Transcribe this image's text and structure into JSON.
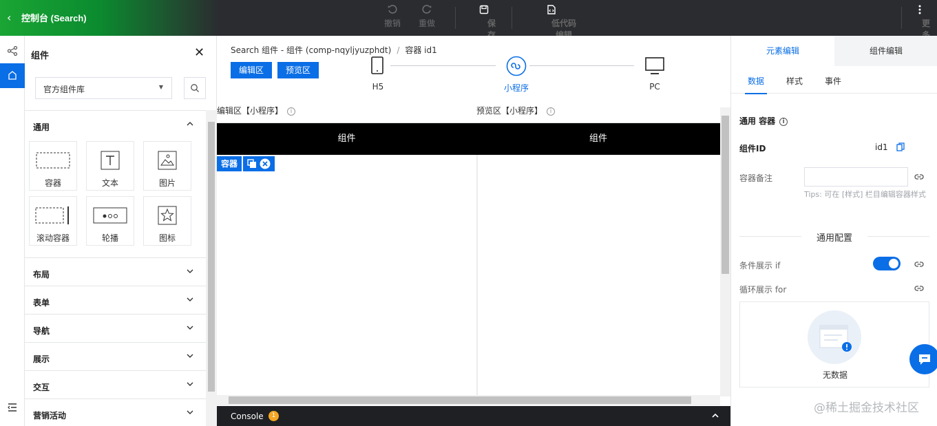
{
  "topbar": {
    "title": "控制台 (Search)",
    "undo_label": "撤销",
    "redo_label": "重做",
    "save_label": "保存",
    "lowcode_label": "低代码编辑",
    "more_label": "更多"
  },
  "left_panel": {
    "title": "组件",
    "library_select": "官方组件库",
    "categories": [
      {
        "name": "通用",
        "expanded": true
      },
      {
        "name": "布局"
      },
      {
        "name": "表单"
      },
      {
        "name": "导航"
      },
      {
        "name": "展示"
      },
      {
        "name": "交互"
      },
      {
        "name": "营销活动"
      }
    ],
    "components": [
      {
        "label": "容器",
        "icon": "container-icon"
      },
      {
        "label": "文本",
        "icon": "text-icon"
      },
      {
        "label": "图片",
        "icon": "image-icon"
      },
      {
        "label": "滚动容器",
        "icon": "scroll-container-icon"
      },
      {
        "label": "轮播",
        "icon": "carousel-icon"
      },
      {
        "label": "图标",
        "icon": "star-icon"
      }
    ]
  },
  "main": {
    "breadcrumb": {
      "path": "Search 组件 - 组件 (comp-nqyljyuzphdt)",
      "current": "容器 id1"
    },
    "edit_area_button": "编辑区",
    "preview_area_button": "预览区",
    "platforms": [
      {
        "label": "H5"
      },
      {
        "label": "小程序",
        "active": true
      },
      {
        "label": "PC"
      }
    ],
    "edit_area_header": "编辑区【小程序】",
    "preview_area_header": "预览区【小程序】",
    "edit_block_title": "组件",
    "preview_block_title": "组件",
    "selection_tag": "容器",
    "console_label": "Console",
    "console_count": "1"
  },
  "right_panel": {
    "tabs": [
      "元素编辑",
      "组件编辑"
    ],
    "subtabs": [
      "数据",
      "样式",
      "事件"
    ],
    "general_container_label": "通用 容器",
    "component_id_label": "组件ID",
    "component_id_value": "id1",
    "container_note_label": "容器备注",
    "container_note_value": "",
    "tips": "Tips: 可在 [样式] 栏目编辑容器样式",
    "general_config_title": "通用配置",
    "conditional_label": "条件展示 if",
    "conditional_on": true,
    "loop_label": "循环展示 for",
    "empty_text": "无数据"
  },
  "watermark": "@稀土掘金技术社区",
  "colors": {
    "accent": "#0a6ee6",
    "brand_green": "#1aa534",
    "dark_bar": "#2b2c30"
  }
}
